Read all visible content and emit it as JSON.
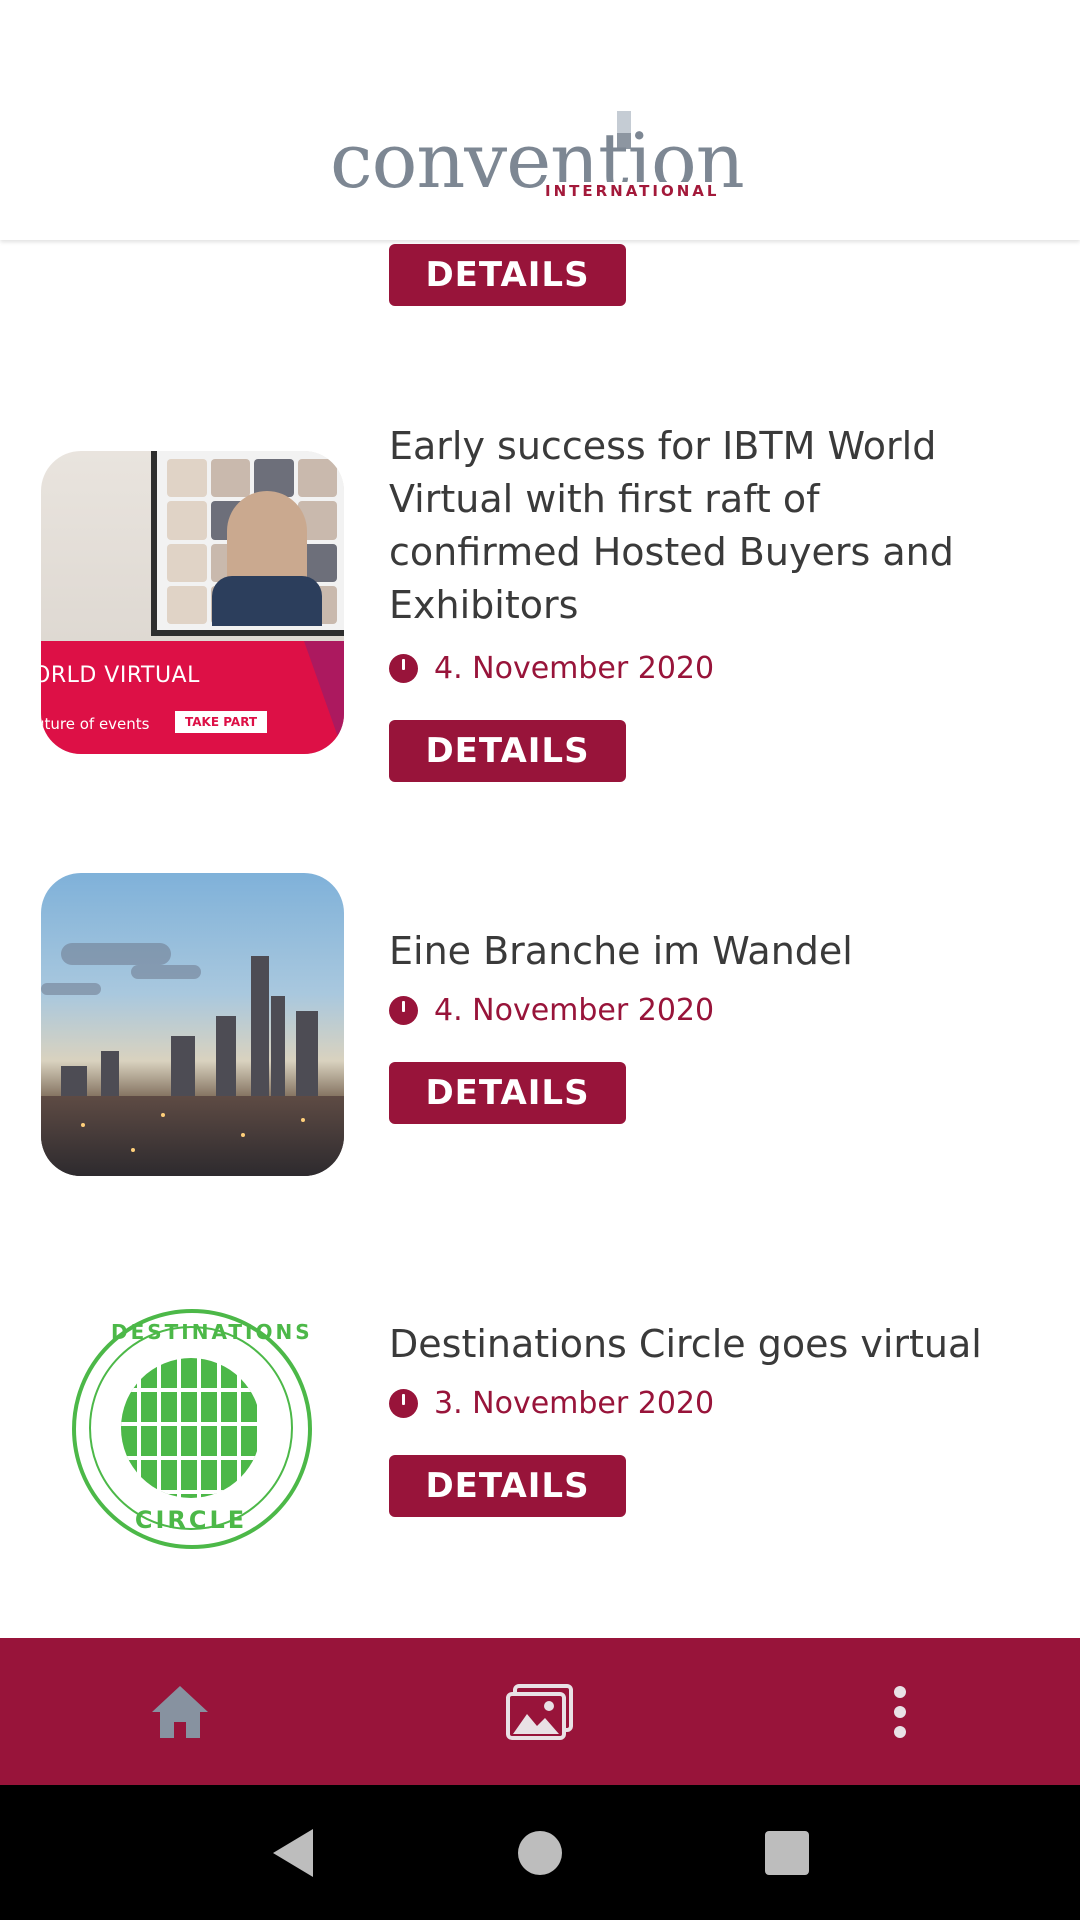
{
  "header": {
    "logo_word": "convention",
    "logo_sub": "INTERNATIONAL"
  },
  "buttons": {
    "details_label": "DETAILS"
  },
  "articles": [
    {
      "title": "Early success for IBTM World Virtual with first raft of confirmed Hosted Buyers and Exhibitors",
      "date": "4. November 2020",
      "thumb_text": "ORLD VIRTUAL",
      "thumb_small": "uture of events",
      "thumb_cta": "TAKE PART"
    },
    {
      "title": "Eine Branche im Wandel",
      "date": "4. November 2020"
    },
    {
      "title": "Destinations Circle goes virtual",
      "date": "3. November 2020",
      "logo_top": "DESTINATIONS",
      "logo_bottom": "CIRCLE"
    }
  ],
  "bottom_nav": {
    "items": [
      {
        "icon": "home-icon"
      },
      {
        "icon": "gallery-icon"
      },
      {
        "icon": "more-vert-icon"
      }
    ]
  },
  "system_nav": {
    "items": [
      {
        "icon": "back-icon"
      },
      {
        "icon": "home-circle-icon"
      },
      {
        "icon": "recents-icon"
      }
    ]
  },
  "colors": {
    "brand": "#98143a",
    "text": "#3a3a3a",
    "logo_gray": "#7d8793",
    "ibtm_red": "#dd1046",
    "dest_green": "#4cb848"
  }
}
